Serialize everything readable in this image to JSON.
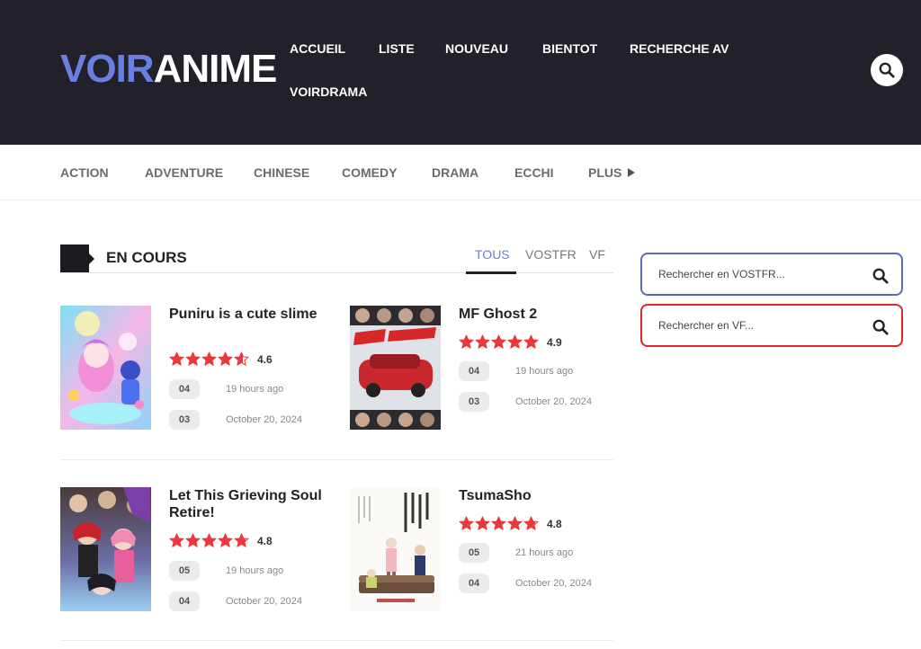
{
  "header": {
    "logo_part1": "VOIR",
    "logo_part2": "ANIME",
    "nav": [
      {
        "label": "ACCUEIL"
      },
      {
        "label": "LISTE"
      },
      {
        "label": "NOUVEAU"
      },
      {
        "label": "BIENTOT"
      },
      {
        "label": "RECHERCHE AV"
      },
      {
        "label": "VOIRDRAMA"
      }
    ],
    "search_icon": "search-icon"
  },
  "genres": [
    {
      "label": "ACTION"
    },
    {
      "label": "ADVENTURE"
    },
    {
      "label": "CHINESE"
    },
    {
      "label": "COMEDY"
    },
    {
      "label": "DRAMA"
    },
    {
      "label": "ECCHI"
    },
    {
      "label": "PLUS"
    }
  ],
  "section": {
    "title": "EN COURS",
    "tabs": [
      {
        "label": "TOUS",
        "active": true
      },
      {
        "label": "VOSTFR",
        "active": false
      },
      {
        "label": "VF",
        "active": false
      }
    ]
  },
  "cards": [
    {
      "title": "Puniru is a cute slime",
      "rating": 4.6,
      "rating_label": "4.6",
      "episodes": [
        {
          "num": "04",
          "time": "19 hours ago"
        },
        {
          "num": "03",
          "time": "October 20, 2024"
        }
      ]
    },
    {
      "title": "MF Ghost 2",
      "rating": 4.9,
      "rating_label": "4.9",
      "episodes": [
        {
          "num": "04",
          "time": "19 hours ago"
        },
        {
          "num": "03",
          "time": "October 20, 2024"
        }
      ]
    },
    {
      "title": "Let This Grieving Soul Retire!",
      "rating": 4.8,
      "rating_label": "4.8",
      "episodes": [
        {
          "num": "05",
          "time": "19 hours ago"
        },
        {
          "num": "04",
          "time": "October 20, 2024"
        }
      ]
    },
    {
      "title": "TsumaSho",
      "rating": 4.8,
      "rating_label": "4.8",
      "episodes": [
        {
          "num": "05",
          "time": "21 hours ago"
        },
        {
          "num": "04",
          "time": "October 20, 2024"
        }
      ]
    }
  ],
  "sidebar": {
    "search_vostfr": {
      "placeholder": "Rechercher en VOSTFR...",
      "border_color": "#5a6db3"
    },
    "search_vf": {
      "placeholder": "Rechercher en VF...",
      "border_color": "#d9262c"
    }
  },
  "colors": {
    "header_bg": "#222129",
    "accent": "#6a7fe3",
    "star": "#e8393b"
  }
}
